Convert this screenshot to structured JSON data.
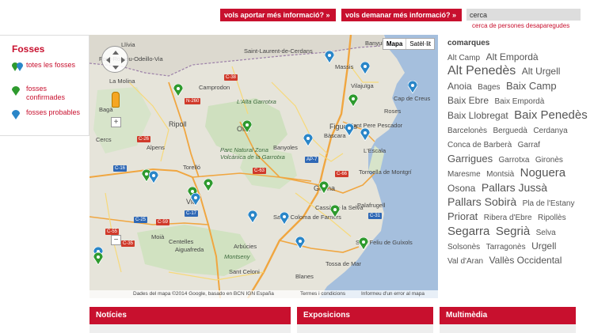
{
  "header": {
    "aportar_label": "vols aportar més informació? »",
    "demanar_label": "vols demanar més informació? »",
    "search_value": "cerca",
    "search_link": "cerca de persones desaparegudes"
  },
  "legend": {
    "title": "Fosses",
    "items": [
      {
        "label": "totes les fosses",
        "icon": "green-blue-pin-icon"
      },
      {
        "label": "fosses confirmades",
        "icon": "green-pin-icon"
      },
      {
        "label": "fosses probables",
        "icon": "blue-pin-icon"
      }
    ]
  },
  "map": {
    "type_map": "Mapa",
    "type_satellite": "Satèl·lit",
    "attribution": "Dades del mapa ©2014 Google, basado en BCN IGN España",
    "terms": "Termes i condicions",
    "report": "Informeu d'un error al mapa",
    "places": [
      "Banyuls",
      "Llívia",
      "Saint-Laurent-de-Cerdans",
      "Massis",
      "Font-Romeu-Odeillo-Via",
      "La Molina",
      "Camprodon",
      "Vilajuïga",
      "Cap de Creus",
      "L'Alta Garrotxa",
      "Roses",
      "Figueres",
      "Bagà",
      "Ripoll",
      "Olot",
      "Sant Pere Pescador",
      "Cercs",
      "Alpens",
      "Parc Natural Zona Volcànica de la Garrotxa",
      "Banyoles",
      "Bàscara",
      "L'Escala",
      "Torelló",
      "Torroella de Montgrí",
      "Girona",
      "Vic",
      "Palafrugell",
      "Cassà de la Selva",
      "Santa Coloma de Farners",
      "Moià",
      "Centelles",
      "Aiguafreda",
      "Arbúcies",
      "Sant Feliu de Guíxols",
      "Montseny",
      "Tossa de Mar",
      "Sant Celoni",
      "Blanes"
    ],
    "roads": [
      "C-38",
      "N-260",
      "C-26",
      "AP-7",
      "C-66",
      "C-63",
      "C-17",
      "C-25",
      "C-59",
      "C-35",
      "C-31",
      "C-55",
      "C-16"
    ]
  },
  "comarques": {
    "title": "comarques",
    "tags": [
      {
        "name": "Alt Camp",
        "size": 10
      },
      {
        "name": "Alt Empordà",
        "size": 12
      },
      {
        "name": "Alt Penedès",
        "size": 16
      },
      {
        "name": "Alt Urgell",
        "size": 12
      },
      {
        "name": "Anoia",
        "size": 12
      },
      {
        "name": "Bages",
        "size": 10
      },
      {
        "name": "Baix Camp",
        "size": 13
      },
      {
        "name": "Baix Ebre",
        "size": 12
      },
      {
        "name": "Baix Empordà",
        "size": 10
      },
      {
        "name": "Baix Llobregat",
        "size": 12
      },
      {
        "name": "Baix Penedès",
        "size": 15
      },
      {
        "name": "Barcelonès",
        "size": 10
      },
      {
        "name": "Berguedà",
        "size": 10
      },
      {
        "name": "Cerdanya",
        "size": 10
      },
      {
        "name": "Conca de Barberà",
        "size": 10
      },
      {
        "name": "Garraf",
        "size": 10
      },
      {
        "name": "Garrigues",
        "size": 13
      },
      {
        "name": "Garrotxa",
        "size": 10
      },
      {
        "name": "Gironès",
        "size": 10
      },
      {
        "name": "Maresme",
        "size": 10
      },
      {
        "name": "Montsià",
        "size": 10
      },
      {
        "name": "Noguera",
        "size": 15
      },
      {
        "name": "Osona",
        "size": 12
      },
      {
        "name": "Pallars Jussà",
        "size": 14
      },
      {
        "name": "Pallars Sobirà",
        "size": 14
      },
      {
        "name": "Pla de l'Estany",
        "size": 10
      },
      {
        "name": "Priorat",
        "size": 13
      },
      {
        "name": "Ribera d'Ebre",
        "size": 10
      },
      {
        "name": "Ripollès",
        "size": 10
      },
      {
        "name": "Segarra",
        "size": 15
      },
      {
        "name": "Segrià",
        "size": 15
      },
      {
        "name": "Selva",
        "size": 10
      },
      {
        "name": "Solsonès",
        "size": 10
      },
      {
        "name": "Tarragonès",
        "size": 10
      },
      {
        "name": "Urgell",
        "size": 12
      },
      {
        "name": "Val d'Aran",
        "size": 10
      },
      {
        "name": "Vallès Occidental",
        "size": 12
      }
    ]
  },
  "sections": {
    "noticies": "Notícies",
    "exposicions": "Exposicions",
    "multimedia": "Multimèdia"
  },
  "colors": {
    "accent": "#c8102e",
    "pin_green": "#2e9a2e",
    "pin_blue": "#2a86c8"
  }
}
